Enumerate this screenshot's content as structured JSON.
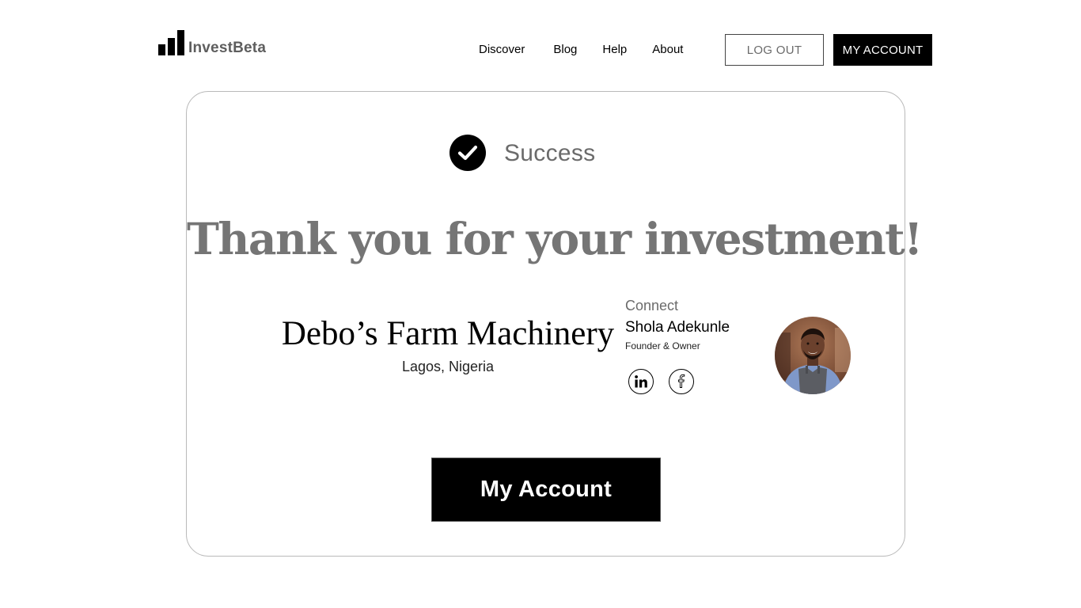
{
  "header": {
    "brand": "InvestBeta",
    "nav": [
      {
        "label": "Discover"
      },
      {
        "label": "Blog"
      },
      {
        "label": "Help"
      },
      {
        "label": "About"
      }
    ],
    "logout_label": "LOG OUT",
    "my_account_label": "MY ACCOUNT"
  },
  "success": {
    "icon": "checkmark-circle-icon",
    "label": "Success"
  },
  "headline": "Thank you for your investment!",
  "company": {
    "name": "Debo’s Farm Machinery",
    "location": "Lagos, Nigeria"
  },
  "founder": {
    "connect_label": "Connect",
    "name": "Shola Adekunle",
    "role": "Founder & Owner",
    "socials": [
      {
        "icon": "linkedin-icon"
      },
      {
        "icon": "facebook-icon"
      }
    ]
  },
  "cta": {
    "label": "My Account"
  },
  "colors": {
    "primary": "#000000",
    "muted_text": "#6b6b6b",
    "card_border": "#b9b9b9"
  }
}
